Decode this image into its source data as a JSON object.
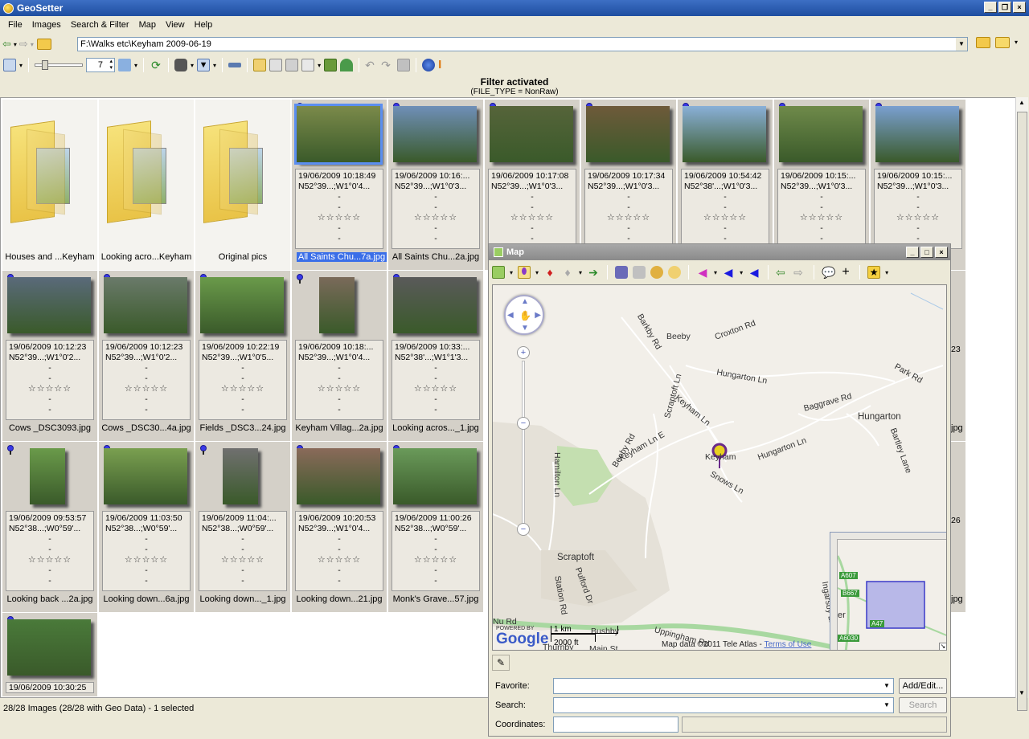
{
  "window": {
    "title": "GeoSetter"
  },
  "menu": [
    "File",
    "Images",
    "Search & Filter",
    "Map",
    "View",
    "Help"
  ],
  "address": {
    "path": "F:\\Walks etc\\Keyham 2009-06-19"
  },
  "toolbar": {
    "zoom_value": "7"
  },
  "filter": {
    "title": "Filter activated",
    "subtitle": "(FILE_TYPE = NonRaw)"
  },
  "thumbnails": [
    {
      "type": "folder",
      "caption": "Houses and ...Keyham"
    },
    {
      "type": "folder",
      "caption": "Looking acro...Keyham"
    },
    {
      "type": "folder",
      "caption": "Original pics"
    },
    {
      "type": "image",
      "date": "19/06/2009 10:18:49",
      "coords": "N52°39...;W1°0'4...",
      "caption": "All Saints Chu...7a.jpg",
      "selected": true,
      "color": "#7b8a4a"
    },
    {
      "type": "image",
      "date": "19/06/2009 10:16:...",
      "coords": "N52°39...;W1°0'3...",
      "caption": "All Saints Chu...2a.jpg",
      "color": "#6f8fb8"
    },
    {
      "type": "image",
      "date": "19/06/2009 10:17:08",
      "coords": "N52°39...;W1°0'3...",
      "caption": "",
      "color": "#56643a"
    },
    {
      "type": "image",
      "date": "19/06/2009 10:17:34",
      "coords": "N52°39...;W1°0'3...",
      "caption": "",
      "color": "#6e5a3a"
    },
    {
      "type": "image",
      "date": "19/06/2009 10:54:42",
      "coords": "N52°38'...;W1°0'3...",
      "caption": "",
      "color": "#8ab0d8"
    },
    {
      "type": "image",
      "date": "19/06/2009 10:15:...",
      "coords": "N52°39...;W1°0'3...",
      "caption": "",
      "color": "#6f8a4a"
    },
    {
      "type": "image",
      "date": "19/06/2009 10:15:...",
      "coords": "N52°39...;W1°0'3...",
      "caption": "",
      "color": "#7aa0d0"
    },
    {
      "type": "image",
      "date": "19/06/2009 10:12:23",
      "coords": "N52°39...;W1°0'2...",
      "caption": "Cows _DSC3093.jpg",
      "color": "#5a6a7a"
    },
    {
      "type": "image",
      "date": "19/06/2009 10:12:23",
      "coords": "N52°39...;W1°0'2...",
      "caption": "Cows _DSC30...4a.jpg",
      "color": "#6a7a6a"
    },
    {
      "type": "image",
      "date": "19/06/2009 10:22:19",
      "coords": "N52°39...;W1°0'5...",
      "caption": "Fields _DSC3...24.jpg",
      "color": "#6a9a4a"
    },
    {
      "type": "image",
      "date": "19/06/2009 10:18:...",
      "coords": "N52°39...;W1°0'4...",
      "caption": "Keyham Villag...2a.jpg",
      "color": "#7a6a5a",
      "portrait": true
    },
    {
      "type": "image",
      "date": "19/06/2009 10:33:...",
      "coords": "N52°38'...;W1°1'3...",
      "caption": "Looking acros..._1.jpg",
      "color": "#5a5a5a"
    },
    {
      "type": "image",
      "date": "19/06/2009 09:53:57",
      "coords": "N52°38...;W0°59'...",
      "caption": "Looking back ...2a.jpg",
      "color": "#6a9a4a",
      "portrait": true
    },
    {
      "type": "image",
      "date": "19/06/2009 11:03:50",
      "coords": "N52°38...;W0°59'...",
      "caption": "Looking down...6a.jpg",
      "color": "#7aa050"
    },
    {
      "type": "image",
      "date": "19/06/2009 11:04:...",
      "coords": "N52°38...;W0°59'...",
      "caption": "Looking down..._1.jpg",
      "color": "#707070",
      "portrait": true
    },
    {
      "type": "image",
      "date": "19/06/2009 10:20:53",
      "coords": "N52°39...;W1°0'4...",
      "caption": "Looking down...21.jpg",
      "color": "#8a6a5a"
    },
    {
      "type": "image",
      "date": "19/06/2009 11:00:26",
      "coords": "N52°38...;W0°59'...",
      "caption": "Monk's Grave...57.jpg",
      "color": "#6a9a5a"
    },
    {
      "type": "image",
      "date": "19/06/2009 10:30:25",
      "coords": "",
      "caption": "",
      "color": "#4a7a3a"
    }
  ],
  "partial_right": {
    "r2": "23",
    "r2b": "jpg",
    "r3": "26",
    "r3b": "jpg"
  },
  "statusbar": {
    "text": "28/28 Images (28/28 with Geo Data) - 1 selected"
  },
  "map": {
    "title": "Map",
    "labels": [
      "Beeby",
      "Croxton Rd",
      "Barkby Rd",
      "Hungarton Ln",
      "Park Rd",
      "Scraptoft Ln",
      "Keyham Ln",
      "Baggrave Rd",
      "Hungarton",
      "Beeby Rd",
      "Keyham Ln E",
      "Hamilton Ln",
      "Hungarton Ln",
      "Keyham",
      "Snows Ln",
      "Scraptoft",
      "Station Rd",
      "Pulford Dr",
      "Bushby",
      "Nu Rd",
      "Main St",
      "Thurnby",
      "Uppingham Rd",
      "Bartley Lane",
      "Ingarsby Ln"
    ],
    "scale_km": "1 km",
    "scale_ft": "2000 ft",
    "powered": "POWERED BY",
    "google": "Google",
    "attribution": "Map data ©2011 Tele Atlas",
    "terms": "Terms of Use",
    "minimap_labels": [
      "A607",
      "B667",
      "A47",
      "A6030",
      "er"
    ]
  },
  "form": {
    "favorite_label": "Favorite:",
    "search_label": "Search:",
    "coordinates_label": "Coordinates:",
    "addedit_button": "Add/Edit...",
    "search_button": "Search",
    "favorite_value": "",
    "search_value": "",
    "coordinates_value": ""
  }
}
